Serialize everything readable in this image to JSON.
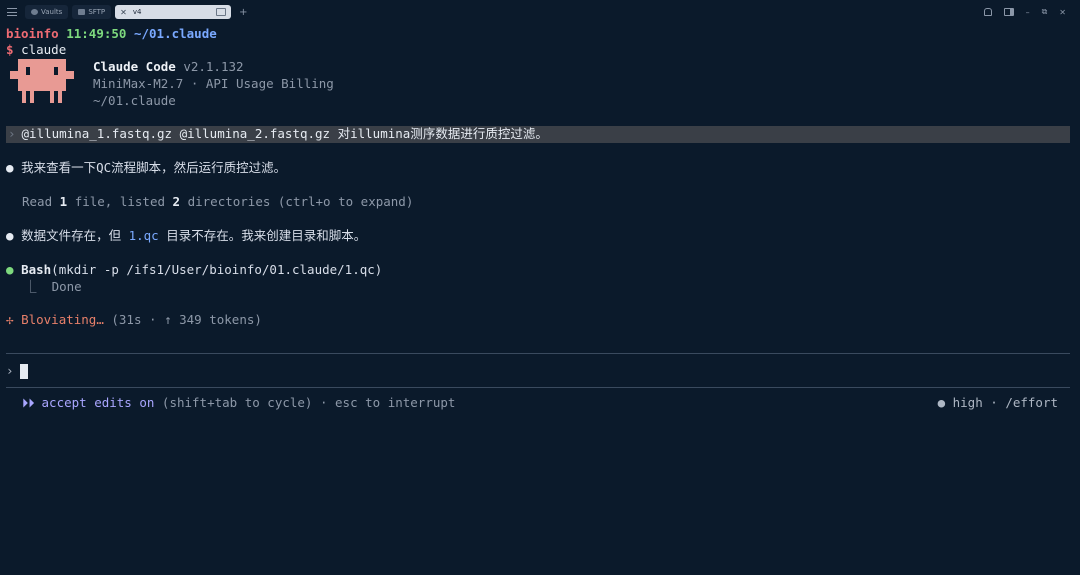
{
  "tabbar": {
    "tabs": [
      {
        "label": "Vaults",
        "icon": "globe-icon"
      },
      {
        "label": "SFTP",
        "icon": "folder-icon"
      },
      {
        "label": "v4",
        "icon": "close-icon",
        "active": true
      }
    ],
    "new_tab": "+"
  },
  "terminal": {
    "prompt": {
      "user": "bioinfo",
      "time": "11:49:50",
      "path": "~/01.claude",
      "dollar": "$",
      "command": "claude"
    },
    "banner": {
      "name": "Claude Code",
      "version": "v2.1.132",
      "model_line": "MiniMax-M2.7 · API Usage Billing",
      "cwd": "~/01.claude"
    },
    "user_message": {
      "chevron": "›",
      "text": "@illumina_1.fastq.gz @illumina_2.fastq.gz 对illumina测序数据进行质控过滤。"
    },
    "assistant1": {
      "bullet": "●",
      "text": "我来查看一下QC流程脚本，然后运行质控过滤。"
    },
    "read_line": {
      "pre": "Read ",
      "files": "1",
      "mid": " file, listed ",
      "dirs": "2",
      "post": " directories (ctrl+o to expand)"
    },
    "assistant2": {
      "bullet": "●",
      "pre": "数据文件存在，但 ",
      "highlight": "1.qc",
      "post": " 目录不存在。我来创建目录和脚本。"
    },
    "bash": {
      "bullet": "●",
      "tool": "Bash",
      "args": "(mkdir -p /ifs1/User/bioinfo/01.claude/1.qc)",
      "result_prefix": "⎿",
      "result": "Done"
    },
    "status_spinner": {
      "icon": "✢",
      "label": "Bloviating…",
      "detail": " (31s · ↑ 349 tokens)"
    },
    "input": {
      "chevron": "›",
      "value": ""
    },
    "footer": {
      "mode_icon": "⏵⏵",
      "mode": "accept edits on",
      "hint": " (shift+tab to cycle) · esc to interrupt",
      "effort_dot": "●",
      "effort": " high · /effort"
    }
  },
  "colors": {
    "background": "#0b1a2b",
    "prompt_user": "#ef6b73",
    "prompt_time": "#7ed97e",
    "prompt_path": "#7aa9ff",
    "spinner": "#e8806a",
    "mode": "#a9a6ff",
    "mascot": "#e89a94"
  }
}
